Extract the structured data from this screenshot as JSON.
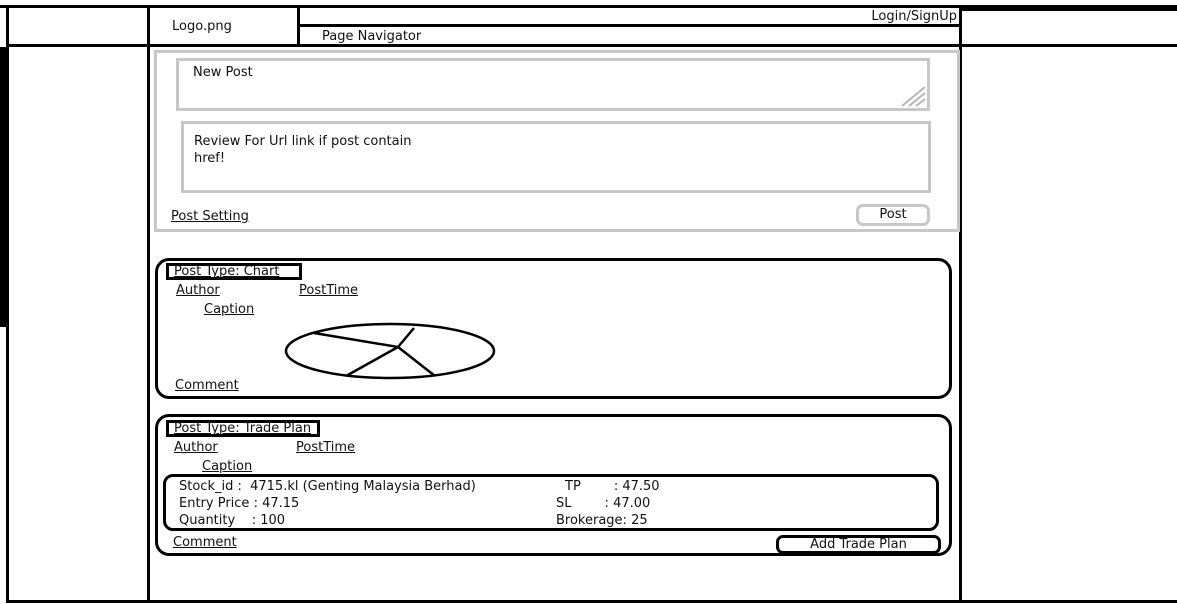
{
  "header": {
    "logo": "Logo.png",
    "login": "Login/SignUp",
    "nav": "Page Navigator"
  },
  "composer": {
    "new_post": "New Post",
    "review_line1": "Review For Url link if post contain",
    "review_line2": "href!",
    "post_setting": "Post Setting",
    "post_button": "Post"
  },
  "chart_post": {
    "type_label": "Post Type: Chart",
    "author": "Author",
    "post_time": "PostTime",
    "caption": "Caption",
    "comment": "Comment",
    "icon": "pie-chart-sketch-icon"
  },
  "trade_post": {
    "type_label": "Post Type: Trade Plan",
    "author": "Author",
    "post_time": "PostTime",
    "caption": "Caption",
    "stock": "Stock_id :  4715.kl (Genting Malaysia Berhad)",
    "entry": "Entry Price : 47.15",
    "quantity": "Quantity    : 100",
    "tp": "TP        : 47.50",
    "sl": "SL        : 47.00",
    "brokerage": "Brokerage: 25",
    "comment": "Comment",
    "add_button": "Add Trade Plan"
  }
}
